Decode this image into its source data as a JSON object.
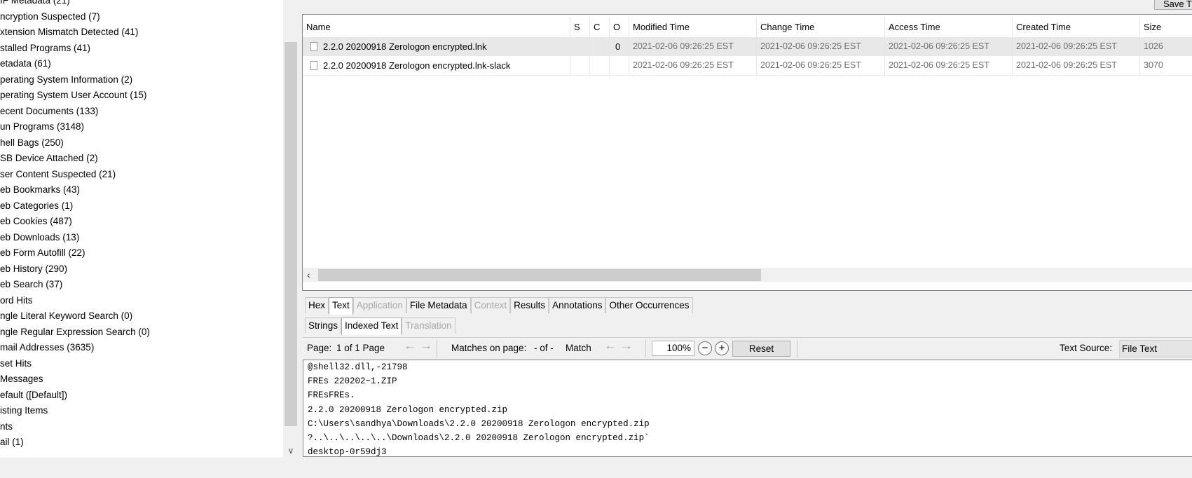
{
  "tree": {
    "items": [
      "IF Metadata (21)",
      "ncryption Suspected (7)",
      "xtension Mismatch Detected (41)",
      "stalled Programs (41)",
      "etadata (61)",
      "perating System Information (2)",
      "perating System User Account (15)",
      "ecent Documents (133)",
      "un Programs (3148)",
      "hell Bags (250)",
      "SB Device Attached (2)",
      "ser Content Suspected (21)",
      "eb Bookmarks (43)",
      "eb Categories (1)",
      "eb Cookies (487)",
      "eb Downloads (13)",
      "eb Form Autofill (22)",
      "eb History (290)",
      "eb Search (37)",
      "ord Hits",
      "ngle Literal Keyword Search (0)",
      "ngle Regular Expression Search (0)",
      "mail Addresses (3635)",
      "set Hits",
      "Messages",
      "efault ([Default])",
      "isting Items",
      "nts",
      "ail (1)"
    ]
  },
  "toolbar_top": {
    "save_label": "Save T"
  },
  "table": {
    "columns": [
      "Name",
      "S",
      "C",
      "O",
      "Modified Time",
      "Change Time",
      "Access Time",
      "Created Time",
      "Size"
    ],
    "rows": [
      {
        "name": "2.2.0 20200918 Zerologon encrypted.lnk",
        "s": "",
        "c": "",
        "o": "0",
        "modified": "2021-02-06 09:26:25 EST",
        "change": "2021-02-06 09:26:25 EST",
        "access": "2021-02-06 09:26:25 EST",
        "created": "2021-02-06 09:26:25 EST",
        "size": "1026"
      },
      {
        "name": "2.2.0 20200918 Zerologon encrypted.lnk-slack",
        "s": "",
        "c": "",
        "o": "",
        "modified": "2021-02-06 09:26:25 EST",
        "change": "2021-02-06 09:26:25 EST",
        "access": "2021-02-06 09:26:25 EST",
        "created": "2021-02-06 09:26:25 EST",
        "size": "3070"
      }
    ]
  },
  "tabs": {
    "main": [
      "Hex",
      "Text",
      "Application",
      "File Metadata",
      "Context",
      "Results",
      "Annotations",
      "Other Occurrences"
    ],
    "sub": [
      "Strings",
      "Indexed Text",
      "Translation"
    ]
  },
  "viewer": {
    "page_label": "Page:",
    "page_value": "1 of 1 Page",
    "matches_label": "Matches on page:",
    "matches_value": "- of -",
    "match_label": "Match",
    "zoom": "100%",
    "reset_label": "Reset",
    "text_source_label": "Text Source:",
    "text_source_value": "File Text",
    "lines": [
      "@shell32.dll,-21798",
      "FREs 220202~1.ZIP",
      "FREsFREs.",
      "2.2.0 20200918 Zerologon encrypted.zip",
      "C:\\Users\\sandhya\\Downloads\\2.2.0 20200918 Zerologon encrypted.zip",
      "?..\\..\\..\\..\\..\\Downloads\\2.2.0 20200918 Zerologon encrypted.zip`",
      "desktop-0r59dj3"
    ]
  },
  "icons": {
    "file": "file-icon",
    "scroll_down": "chevron-down-icon",
    "scroll_left": "chevron-left-icon",
    "prev": "arrow-left-icon",
    "next": "arrow-right-icon",
    "zoom_out": "zoom-out-icon",
    "zoom_in": "zoom-in-icon"
  }
}
